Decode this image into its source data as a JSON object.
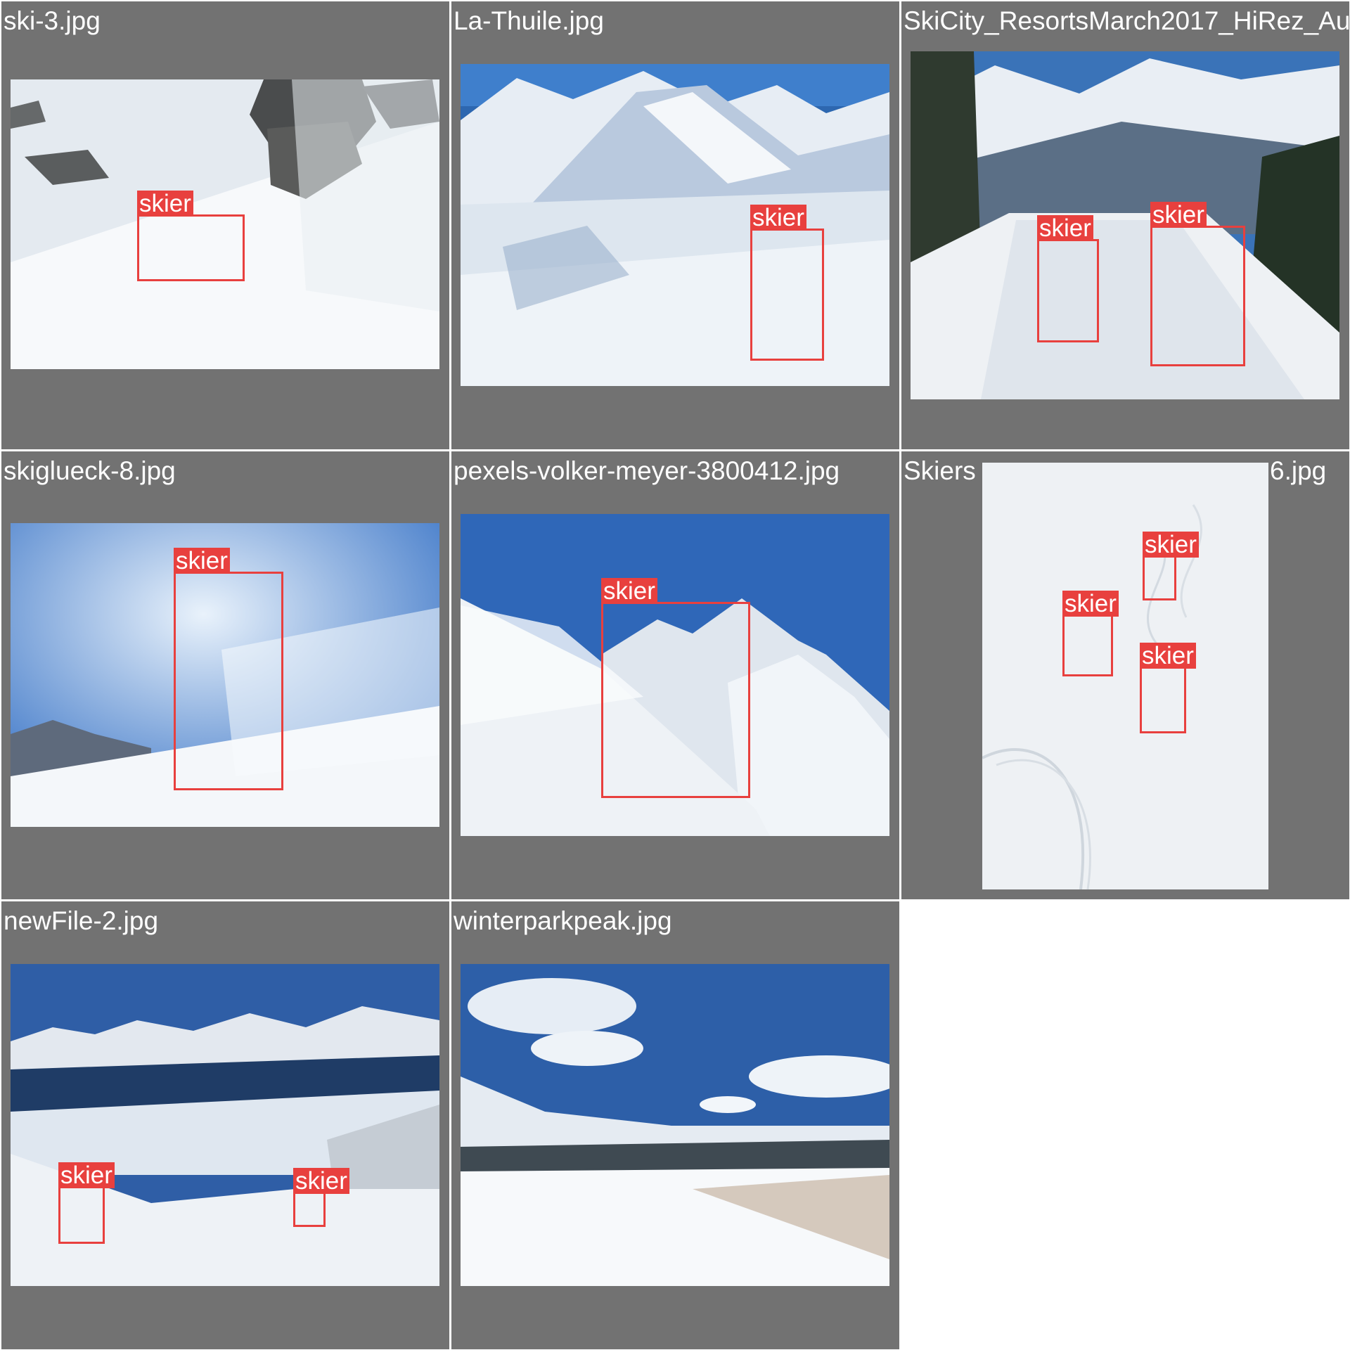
{
  "grid": {
    "tiles": [
      {
        "filename": "ski-3.jpg",
        "detections": [
          {
            "label": "skier"
          }
        ]
      },
      {
        "filename": "La-Thuile.jpg",
        "detections": [
          {
            "label": "skier"
          }
        ]
      },
      {
        "filename": "SkiCity_ResortsMarch2017_HiRez_Au",
        "detections": [
          {
            "label": "skier"
          },
          {
            "label": "skier"
          }
        ]
      },
      {
        "filename": "skiglueck-8.jpg",
        "detections": [
          {
            "label": "skier"
          }
        ]
      },
      {
        "filename": "pexels-volker-meyer-3800412.jpg",
        "detections": [
          {
            "label": "skier"
          }
        ]
      },
      {
        "filename": "Skiers",
        "filename_tail": "6.jpg",
        "detections": [
          {
            "label": "skier"
          },
          {
            "label": "skier"
          },
          {
            "label": "skier"
          }
        ]
      },
      {
        "filename": "newFile-2.jpg",
        "detections": [
          {
            "label": "skier"
          },
          {
            "label": "skier"
          }
        ]
      },
      {
        "filename": "winterparkpeak.jpg",
        "detections": []
      }
    ]
  },
  "colors": {
    "tile_background": "#727272",
    "box": "#e8403e",
    "label_text": "#ffffff"
  }
}
